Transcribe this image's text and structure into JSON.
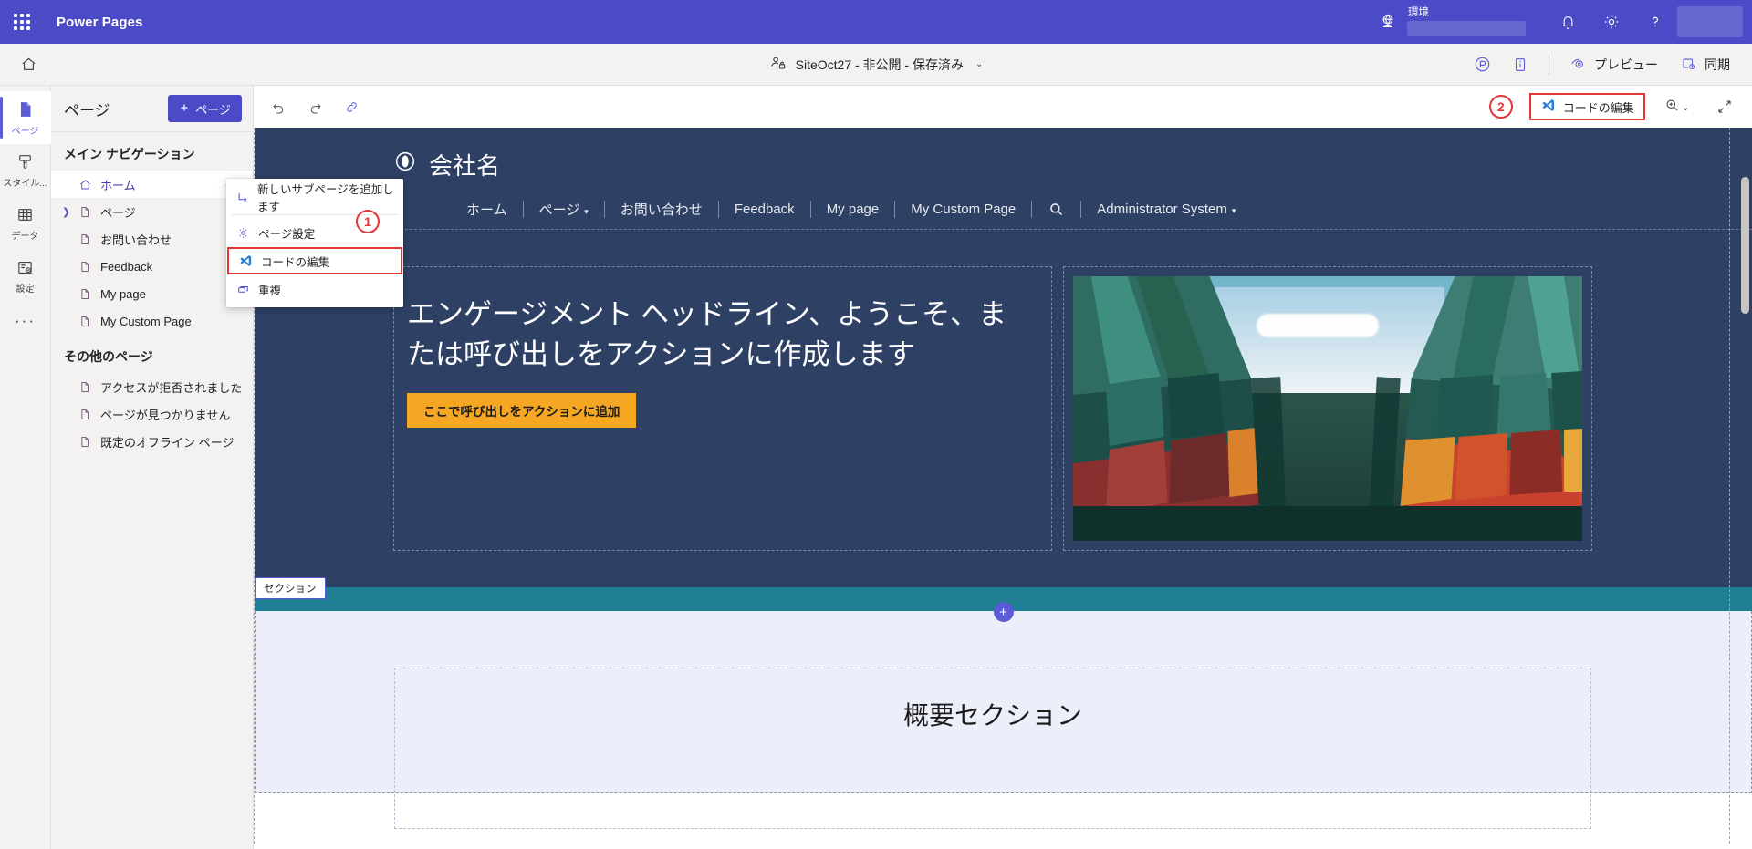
{
  "suite": {
    "app_name": "Power Pages",
    "waffle_icon": "app-launcher-icon",
    "environment_label": "環境",
    "environment_value": "",
    "env_icon": "environment-globe-icon",
    "notifications_icon": "bell-icon",
    "settings_icon": "gear-icon",
    "help_icon": "question-mark-icon"
  },
  "command_bar": {
    "home_icon": "home-icon",
    "site_name": "SiteOct27 - 非公開 - 保存済み",
    "site_icon": "site-visibility-lock-icon",
    "site_chevron": "⌄",
    "play_icon": "power-apps-icon",
    "info_icon": "info-panel-icon",
    "preview_label": "プレビュー",
    "preview_icon": "preview-eye-icon",
    "sync_label": "同期",
    "sync_icon": "sync-icon"
  },
  "rail": {
    "items": [
      {
        "label": "ページ",
        "icon": "page-icon",
        "active": true
      },
      {
        "label": "スタイル...",
        "icon": "style-brush-icon",
        "active": false
      },
      {
        "label": "データ",
        "icon": "data-table-icon",
        "active": false
      },
      {
        "label": "設定",
        "icon": "setup-gear-icon",
        "active": false
      }
    ],
    "more_label": "···"
  },
  "pages_panel": {
    "title": "ページ",
    "add_button_label": "ページ",
    "add_button_icon": "plus-icon",
    "main_nav_title": "メイン ナビゲーション",
    "main_nav_items": [
      {
        "label": "ホーム",
        "icon": "home-page-icon",
        "selected": true,
        "expandable": false,
        "has_ellipsis": true
      },
      {
        "label": "ページ",
        "icon": "file-icon",
        "selected": false,
        "expandable": true,
        "has_ellipsis": false
      },
      {
        "label": "お問い合わせ",
        "icon": "file-icon",
        "selected": false,
        "expandable": false,
        "has_ellipsis": false
      },
      {
        "label": "Feedback",
        "icon": "file-icon",
        "selected": false,
        "expandable": false,
        "has_ellipsis": false
      },
      {
        "label": "My page",
        "icon": "file-icon",
        "selected": false,
        "expandable": false,
        "has_ellipsis": false
      },
      {
        "label": "My Custom Page",
        "icon": "file-icon",
        "selected": false,
        "expandable": false,
        "has_ellipsis": false
      }
    ],
    "other_pages_title": "その他のページ",
    "other_pages_items": [
      {
        "label": "アクセスが拒否されました",
        "icon": "file-icon"
      },
      {
        "label": "ページが見つかりません",
        "icon": "file-icon"
      },
      {
        "label": "既定のオフライン ページ",
        "icon": "file-icon"
      }
    ]
  },
  "context_menu": {
    "items": [
      {
        "label": "新しいサブページを追加します",
        "icon": "add-subpage-icon",
        "highlighted": false
      },
      {
        "label": "ページ設定",
        "icon": "gear-icon",
        "highlighted": false
      },
      {
        "label": "コードの編集",
        "icon": "vscode-icon",
        "highlighted": true
      },
      {
        "label": "重複",
        "icon": "duplicate-icon",
        "highlighted": false
      }
    ]
  },
  "annotations": {
    "badge_1": "1",
    "badge_2": "2",
    "color": "#e33636"
  },
  "canvas_toolbar": {
    "undo_icon": "undo-icon",
    "redo_icon": "redo-icon",
    "link_icon": "link-icon",
    "edit_code_label": "コードの編集",
    "edit_code_icon": "vscode-icon",
    "zoom_icon": "zoom-in-icon",
    "zoom_chevron": "⌄",
    "expand_icon": "expand-arrows-icon"
  },
  "site_preview": {
    "brand_name": "会社名",
    "brand_icon": "circle-logo-icon",
    "nav_items": [
      {
        "label": "ホーム",
        "has_caret": false
      },
      {
        "label": "ページ",
        "has_caret": true
      },
      {
        "label": "お問い合わせ",
        "has_caret": false
      },
      {
        "label": "Feedback",
        "has_caret": false
      },
      {
        "label": "My page",
        "has_caret": false
      },
      {
        "label": "My Custom Page",
        "has_caret": false
      }
    ],
    "search_icon": "search-icon",
    "account_label": "Administrator System",
    "account_caret": "▾",
    "hero": {
      "headline": "エンゲージメント ヘッドライン、ようこそ、または呼び出しをアクションに作成します",
      "cta_label": "ここで呼び出しをアクションに追加",
      "image_alt": "shipping-containers-photo"
    },
    "section_tag": "セクション",
    "add_section_icon": "plus-icon",
    "overview_title": "概要セクション"
  },
  "colors": {
    "suite_bar": "#4b4bc8",
    "accent": "#5b5bd6",
    "site_header": "#2e4164",
    "cta": "#f5a623",
    "section_band": "#1f7e93",
    "annotation_red": "#e33636"
  }
}
